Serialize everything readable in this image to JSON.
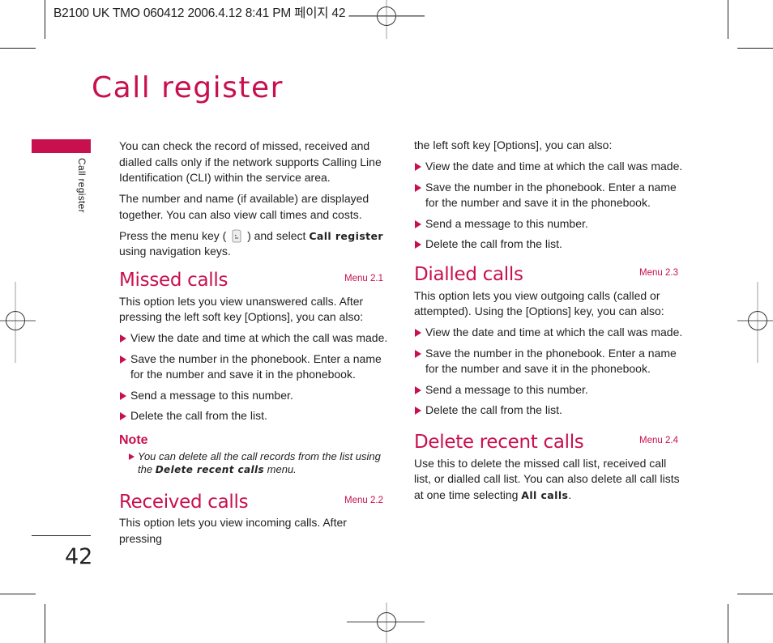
{
  "slug": {
    "text": "B2100 UK TMO 060412  2006.4.12 8:41 PM 페이지 42"
  },
  "page": {
    "title": "Call register",
    "side_label": "Call register",
    "number": "42",
    "accent_color": "#c8104e"
  },
  "intro": {
    "p1": "You can check the record of missed, received and dialled calls only if the network supports Calling Line Identification (CLI) within the service area.",
    "p2": "The number and name (if available) are displayed together. You can also view call times and costs.",
    "p3_before": "Press the menu key (",
    "p3_icon": "menu-key-icon",
    "p3_middle": ") and select ",
    "p3_term": "Call register",
    "p3_after": " using navigation keys."
  },
  "sections": {
    "missed": {
      "title": "Missed calls",
      "menu": "Menu 2.1",
      "body": "This option lets you view unanswered calls. After pressing the left soft key [Options], you can also:",
      "bullets": [
        "View the date and time at which the call was made.",
        "Save the number in the phonebook. Enter a name for the number and save it in the phonebook.",
        "Send a message to this number.",
        "Delete the call from the list."
      ]
    },
    "note": {
      "title": "Note",
      "before": "You can delete all the call records from the list using the ",
      "term": "Delete recent calls",
      "after": " menu."
    },
    "received": {
      "title": "Received calls",
      "menu": "Menu 2.2",
      "body_col1": "This option lets you view incoming calls. After pressing",
      "body_col2": "the left soft key [Options], you can also:",
      "bullets": [
        "View the date and time at which the call was made.",
        "Save the number in the phonebook. Enter a name for the number and save it in the phonebook.",
        "Send a message to this number.",
        "Delete the call from the list."
      ]
    },
    "dialled": {
      "title": "Dialled calls",
      "menu": "Menu 2.3",
      "body": "This option lets you view outgoing calls (called or attempted). Using the [Options] key, you can also:",
      "bullets": [
        "View the date and time at which the call was made.",
        "Save the number in the phonebook. Enter a name for the number and save it in the phonebook.",
        "Send a message to this number.",
        "Delete the call from the list."
      ]
    },
    "delete": {
      "title": "Delete recent calls",
      "menu": "Menu 2.4",
      "body_before": "Use this to delete the missed call list, received call list, or dialled call list. You can also delete all call lists at one time selecting ",
      "body_term": "All calls",
      "body_after": "."
    }
  }
}
